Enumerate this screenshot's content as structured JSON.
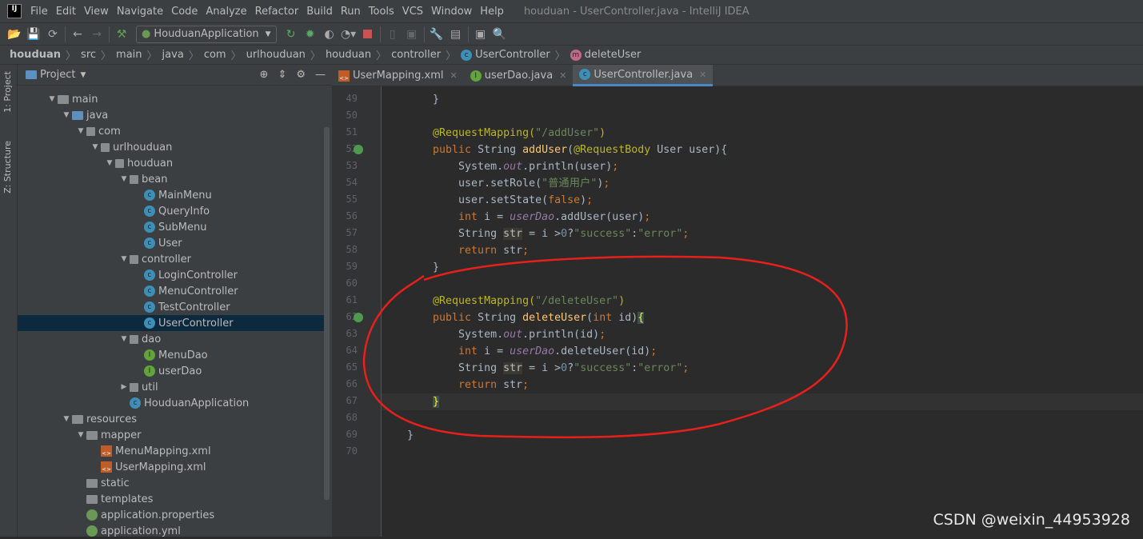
{
  "app": {
    "title": "houduan - UserController.java - IntelliJ IDEA",
    "logo": "IJ"
  },
  "menu": [
    "File",
    "Edit",
    "View",
    "Navigate",
    "Code",
    "Analyze",
    "Refactor",
    "Build",
    "Run",
    "Tools",
    "VCS",
    "Window",
    "Help"
  ],
  "toolbar": {
    "run_config": "HouduanApplication",
    "icons": [
      "open-icon",
      "save-icon",
      "sync-icon",
      "back-icon",
      "forward-icon",
      "build-icon",
      "rerun-icon",
      "debug-icon",
      "coverage-icon",
      "profile-icon",
      "stop-icon",
      "device-icon",
      "deploy-icon",
      "settings-wrench-icon",
      "project-structure-icon",
      "terminal-icon",
      "search-icon"
    ]
  },
  "breadcrumb": [
    "houduan",
    "src",
    "main",
    "java",
    "com",
    "urlhouduan",
    "houduan",
    "controller",
    "UserController",
    "deleteUser"
  ],
  "side_tabs": {
    "project": "1: Project",
    "structure": "Z: Structure"
  },
  "project_panel": {
    "title": "Project",
    "tree": [
      {
        "label": "main",
        "depth": 0,
        "type": "folder",
        "open": true
      },
      {
        "label": "java",
        "depth": 1,
        "type": "folder-blue",
        "open": true
      },
      {
        "label": "com",
        "depth": 2,
        "type": "package",
        "open": true
      },
      {
        "label": "urlhouduan",
        "depth": 3,
        "type": "package",
        "open": true
      },
      {
        "label": "houduan",
        "depth": 4,
        "type": "package",
        "open": true
      },
      {
        "label": "bean",
        "depth": 5,
        "type": "package",
        "open": true
      },
      {
        "label": "MainMenu",
        "depth": 6,
        "type": "class"
      },
      {
        "label": "QueryInfo",
        "depth": 6,
        "type": "class"
      },
      {
        "label": "SubMenu",
        "depth": 6,
        "type": "class"
      },
      {
        "label": "User",
        "depth": 6,
        "type": "class"
      },
      {
        "label": "controller",
        "depth": 5,
        "type": "package",
        "open": true
      },
      {
        "label": "LoginController",
        "depth": 6,
        "type": "class"
      },
      {
        "label": "MenuController",
        "depth": 6,
        "type": "class"
      },
      {
        "label": "TestController",
        "depth": 6,
        "type": "class"
      },
      {
        "label": "UserController",
        "depth": 6,
        "type": "class",
        "selected": true
      },
      {
        "label": "dao",
        "depth": 5,
        "type": "package",
        "open": true
      },
      {
        "label": "MenuDao",
        "depth": 6,
        "type": "interface"
      },
      {
        "label": "userDao",
        "depth": 6,
        "type": "interface"
      },
      {
        "label": "util",
        "depth": 5,
        "type": "package",
        "open": false
      },
      {
        "label": "HouduanApplication",
        "depth": 5,
        "type": "spring-class"
      },
      {
        "label": "resources",
        "depth": 1,
        "type": "folder",
        "open": true
      },
      {
        "label": "mapper",
        "depth": 2,
        "type": "folder",
        "open": true
      },
      {
        "label": "MenuMapping.xml",
        "depth": 3,
        "type": "xml"
      },
      {
        "label": "UserMapping.xml",
        "depth": 3,
        "type": "xml"
      },
      {
        "label": "static",
        "depth": 2,
        "type": "folder"
      },
      {
        "label": "templates",
        "depth": 2,
        "type": "folder"
      },
      {
        "label": "application.properties",
        "depth": 2,
        "type": "spring"
      },
      {
        "label": "application.yml",
        "depth": 2,
        "type": "spring"
      }
    ]
  },
  "editor": {
    "tabs": [
      {
        "label": "UserMapping.xml",
        "icon": "xml"
      },
      {
        "label": "userDao.java",
        "icon": "interface"
      },
      {
        "label": "UserController.java",
        "icon": "class",
        "active": true
      }
    ],
    "current_line": 67,
    "lines": [
      {
        "n": 49,
        "t": [
          [
            "    }",
            "pl"
          ]
        ]
      },
      {
        "n": 50,
        "t": []
      },
      {
        "n": 51,
        "t": [
          [
            "    @RequestMapping(",
            "ann"
          ],
          [
            "\"/addUser\"",
            "str"
          ],
          [
            ")",
            "ann"
          ]
        ]
      },
      {
        "n": 52,
        "t": [
          [
            "    public ",
            "kw"
          ],
          [
            "String ",
            "pl"
          ],
          [
            "addUser",
            "fn"
          ],
          [
            "(",
            "pl"
          ],
          [
            "@RequestBody ",
            "ann"
          ],
          [
            "User user){",
            "pl"
          ]
        ],
        "gutter": true
      },
      {
        "n": 53,
        "t": [
          [
            "        System.",
            "pl"
          ],
          [
            "out",
            "fld"
          ],
          [
            ".println(user)",
            "pl"
          ],
          [
            ";",
            "pu"
          ]
        ]
      },
      {
        "n": 54,
        "t": [
          [
            "        user.setRole(",
            "pl"
          ],
          [
            "\"普通用户\"",
            "str"
          ],
          [
            ")",
            "pl"
          ],
          [
            ";",
            "pu"
          ]
        ]
      },
      {
        "n": 55,
        "t": [
          [
            "        user.setState(",
            "pl"
          ],
          [
            "false",
            "kw"
          ],
          [
            ")",
            "pl"
          ],
          [
            ";",
            "pu"
          ]
        ]
      },
      {
        "n": 56,
        "t": [
          [
            "        int ",
            "kw"
          ],
          [
            "i = ",
            "pl"
          ],
          [
            "userDao",
            "fld"
          ],
          [
            ".addUser(user)",
            "pl"
          ],
          [
            ";",
            "pu"
          ]
        ]
      },
      {
        "n": 57,
        "t": [
          [
            "        String ",
            "pl"
          ],
          [
            "str",
            "hl"
          ],
          [
            " = i >",
            "pl"
          ],
          [
            "0",
            "num"
          ],
          [
            "?",
            "pl"
          ],
          [
            "\"success\"",
            "str"
          ],
          [
            ":",
            "pl"
          ],
          [
            "\"error\"",
            "str"
          ],
          [
            ";",
            "pu"
          ]
        ]
      },
      {
        "n": 58,
        "t": [
          [
            "        return ",
            "kw"
          ],
          [
            "str",
            "pl"
          ],
          [
            ";",
            "pu"
          ]
        ]
      },
      {
        "n": 59,
        "t": [
          [
            "    }",
            "pl"
          ]
        ]
      },
      {
        "n": 60,
        "t": []
      },
      {
        "n": 61,
        "t": [
          [
            "    @RequestMapping(",
            "ann"
          ],
          [
            "\"/deleteUser\"",
            "str"
          ],
          [
            ")",
            "ann"
          ]
        ]
      },
      {
        "n": 62,
        "t": [
          [
            "    public ",
            "kw"
          ],
          [
            "String ",
            "pl"
          ],
          [
            "deleteUser",
            "fn"
          ],
          [
            "(",
            "pl"
          ],
          [
            "int ",
            "kw"
          ],
          [
            "id)",
            "pl"
          ],
          [
            "{",
            "br"
          ]
        ],
        "gutter": true
      },
      {
        "n": 63,
        "t": [
          [
            "        System.",
            "pl"
          ],
          [
            "out",
            "fld"
          ],
          [
            ".println(id)",
            "pl"
          ],
          [
            ";",
            "pu"
          ]
        ]
      },
      {
        "n": 64,
        "t": [
          [
            "        int ",
            "kw"
          ],
          [
            "i = ",
            "pl"
          ],
          [
            "userDao",
            "fld"
          ],
          [
            ".deleteUser(id)",
            "pl"
          ],
          [
            ";",
            "pu"
          ]
        ]
      },
      {
        "n": 65,
        "t": [
          [
            "        String ",
            "pl"
          ],
          [
            "str",
            "hl"
          ],
          [
            " = i >",
            "pl"
          ],
          [
            "0",
            "num"
          ],
          [
            "?",
            "pl"
          ],
          [
            "\"success\"",
            "str"
          ],
          [
            ":",
            "pl"
          ],
          [
            "\"error\"",
            "str"
          ],
          [
            ";",
            "pu"
          ]
        ]
      },
      {
        "n": 66,
        "t": [
          [
            "        return ",
            "kw"
          ],
          [
            "str",
            "pl"
          ],
          [
            ";",
            "pu"
          ]
        ]
      },
      {
        "n": 67,
        "t": [
          [
            "    ",
            "pl"
          ],
          [
            "}",
            "br"
          ]
        ]
      },
      {
        "n": 68,
        "t": []
      },
      {
        "n": 69,
        "t": [
          [
            "}",
            "pl"
          ]
        ]
      },
      {
        "n": 70,
        "t": []
      }
    ]
  },
  "annotation": {
    "color": "#e8201c"
  },
  "watermark": "CSDN @weixin_44953928"
}
